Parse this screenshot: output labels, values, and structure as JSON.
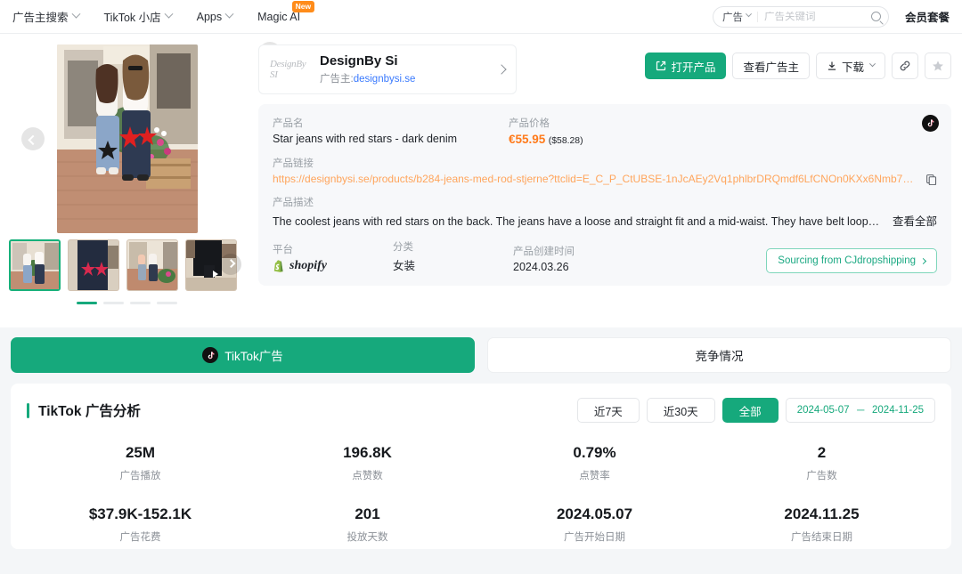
{
  "nav": {
    "items": [
      {
        "label": "广告主搜索",
        "caret": true,
        "badge": null
      },
      {
        "label": "TikTok 小店",
        "caret": true,
        "badge": null
      },
      {
        "label": "Apps",
        "caret": true,
        "badge": null
      },
      {
        "label": "Magic AI",
        "caret": false,
        "badge": "New"
      }
    ],
    "search": {
      "scope": "广告",
      "placeholder": "广告关键词",
      "value": ""
    },
    "vip_label": "会员套餐"
  },
  "advertiser": {
    "logo_text": "DesignBy SI",
    "name": "DesignBy Si",
    "sub_prefix": "广告主:",
    "sub_link": "designbysi.se"
  },
  "actions": {
    "open_product": "打开产品",
    "view_advertiser": "查看广告主",
    "download": "下载",
    "link_icon": "link-icon",
    "star_icon": "star-icon"
  },
  "product": {
    "name_label": "产品名",
    "name": "Star jeans with red stars - dark denim",
    "price_label": "产品价格",
    "price": "€55.95",
    "price_usd": "($58.28)",
    "link_label": "产品链接",
    "link": "https://designbysi.se/products/b284-jeans-med-rod-stjerne?ttclid=E_C_P_CtUBSE-1nJcAEy2Vq1phlbrDRQmdf6LfCNOn0KXx6Nmb7YjqQ_JU...",
    "desc_label": "产品描述",
    "desc": "The coolest jeans with red stars on the back. The jeans have a loose and straight fit and a mid-waist. They have belt loops and a zipp...",
    "desc_more": "查看全部",
    "platform_label": "平台",
    "platform": "shopify",
    "category_label": "分类",
    "category": "女装",
    "created_label": "产品创建时间",
    "created": "2024.03.26",
    "sourcing_label": "Sourcing from CJdropshipping"
  },
  "tabs": [
    {
      "label": "TikTok广告",
      "icon": "tiktok-icon",
      "active": true
    },
    {
      "label": "竞争情况",
      "icon": null,
      "active": false
    }
  ],
  "analysis": {
    "title": "TikTok 广告分析",
    "filters": [
      {
        "label": "近7天",
        "active": false
      },
      {
        "label": "近30天",
        "active": false
      },
      {
        "label": "全部",
        "active": true
      }
    ],
    "date_from": "2024-05-07",
    "date_sep": "－",
    "date_to": "2024-11-25",
    "stats_row1": [
      {
        "value": "25M",
        "caption": "广告播放"
      },
      {
        "value": "196.8K",
        "caption": "点赞数"
      },
      {
        "value": "0.79%",
        "caption": "点赞率"
      },
      {
        "value": "2",
        "caption": "广告数"
      }
    ],
    "stats_row2": [
      {
        "value": "$37.9K-152.1K",
        "caption": "广告花费"
      },
      {
        "value": "201",
        "caption": "投放天数"
      },
      {
        "value": "2024.05.07",
        "caption": "广告开始日期"
      },
      {
        "value": "2024.11.25",
        "caption": "广告结束日期"
      }
    ]
  },
  "gallery": {
    "prev_icon": "chevron-left-icon",
    "next_icon": "chevron-right-icon",
    "selected_index": 0,
    "thumb_count": 4,
    "dot_count": 4
  },
  "colors": {
    "accent": "#16a97c",
    "price": "#ff7a1a",
    "link": "#ffa55c",
    "badge": "#ff8c1a"
  }
}
